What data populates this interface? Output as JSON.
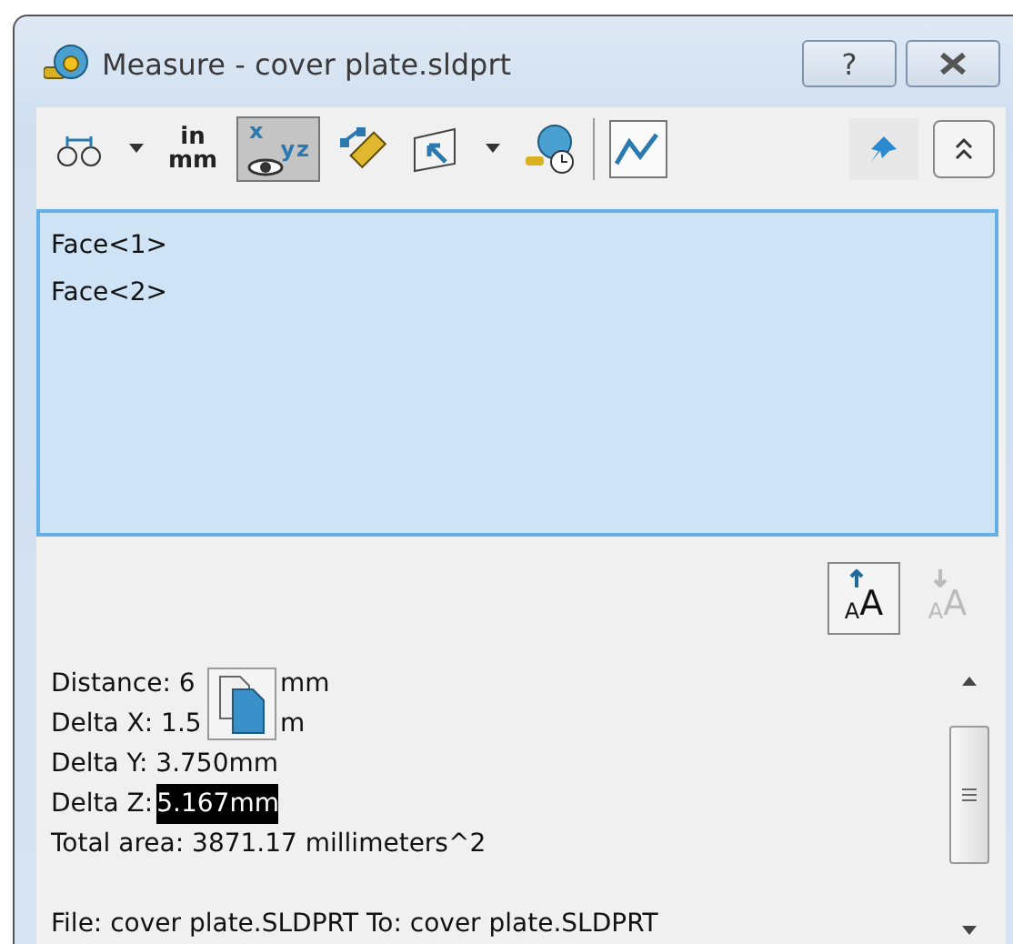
{
  "window": {
    "title": "Measure - cover plate.sldprt",
    "help_label": "?"
  },
  "toolbar": [
    {
      "kind": "arc",
      "selected": false
    },
    {
      "kind": "caret"
    },
    {
      "kind": "units",
      "label": "in",
      "sublabel": "mm",
      "selected": false
    },
    {
      "kind": "xyz",
      "label": "x",
      "sublabel": "yz",
      "selected": true
    },
    {
      "kind": "ruler",
      "selected": false
    },
    {
      "kind": "projection",
      "selected": false
    },
    {
      "kind": "caret"
    },
    {
      "kind": "history",
      "selected": false
    },
    {
      "kind": "divider"
    },
    {
      "kind": "chart",
      "selected": false
    }
  ],
  "pin": {
    "on": true
  },
  "selections": [
    "Face<1>",
    "Face<2>"
  ],
  "text_size_buttons": [
    {
      "kind": "increase",
      "label": "AA",
      "disabled": false
    },
    {
      "kind": "decrease",
      "label": "AA",
      "disabled": true
    }
  ],
  "results": [
    {
      "parts": [
        "Distance: 6",
        "mm"
      ]
    },
    {
      "parts": [
        "Delta X: 1.5",
        "m"
      ]
    },
    {
      "parts": [
        "Delta Y: 3.750mm"
      ]
    },
    {
      "parts": [
        "Delta Z:"
      ],
      "highlight": "5.167mm"
    },
    {
      "parts": [
        "Total area: 3871.17 millimeters^2"
      ]
    },
    {
      "parts": [
        "File: cover plate.SLDPRT To: cover plate.SLDPRT"
      ],
      "separated": true
    }
  ]
}
